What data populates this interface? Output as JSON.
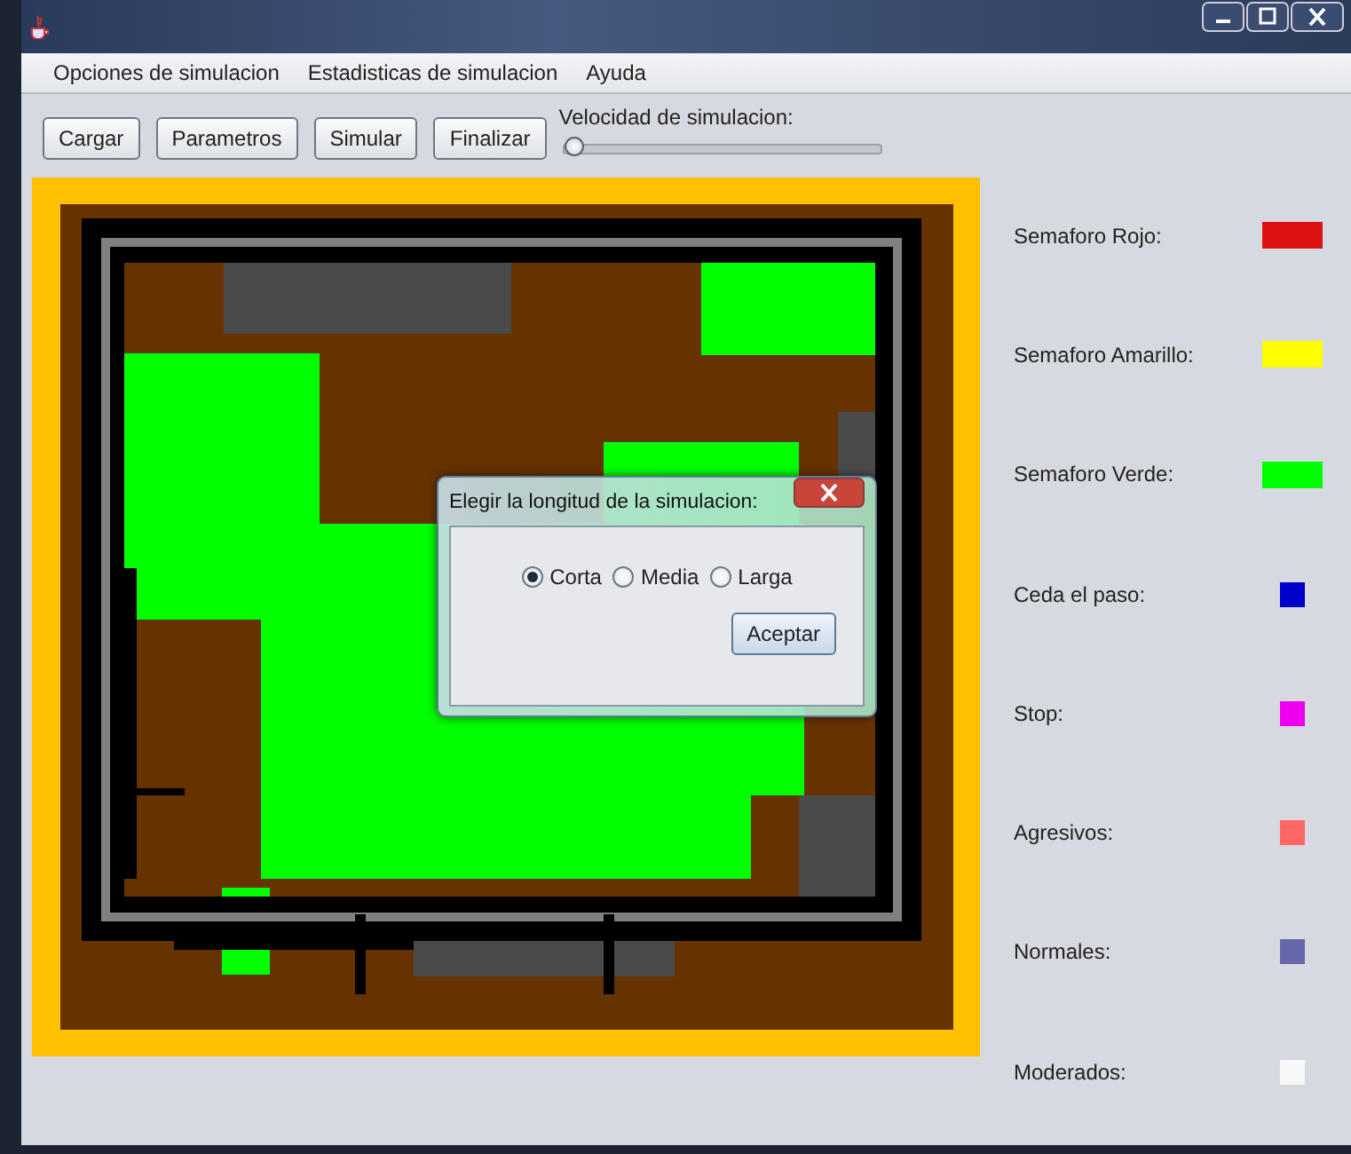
{
  "menu": [
    {
      "label": "Opciones de simulacion"
    },
    {
      "label": "Estadisticas de simulacion"
    },
    {
      "label": "Ayuda"
    }
  ],
  "toolbar": {
    "buttons": [
      "Cargar",
      "Parametros",
      "Simular",
      "Finalizar"
    ],
    "speed": {
      "label": "Velocidad de simulacion:",
      "level": 0
    }
  },
  "legend": [
    {
      "label": "Semaforo Rojo:",
      "color": "#dd1111",
      "kind": "wide"
    },
    {
      "label": "Semaforo Amarillo:",
      "color": "#ffff00",
      "kind": "wide"
    },
    {
      "label": "Semaforo Verde:",
      "color": "#00ff00",
      "kind": "wide"
    },
    {
      "label": "Ceda el paso:",
      "color": "#0000cc",
      "kind": "square"
    },
    {
      "label": "Stop:",
      "color": "#ee00ee",
      "kind": "square"
    },
    {
      "label": "Agresivos:",
      "color": "#ff6666",
      "kind": "square"
    },
    {
      "label": "Normales:",
      "color": "#6666aa",
      "kind": "square"
    },
    {
      "label": "Moderados:",
      "color": "#f8f8f8",
      "kind": "square"
    }
  ],
  "dialog": {
    "title": "Elegir la longitud de la simulacion:",
    "options": [
      {
        "label": "Corta",
        "selected": true
      },
      {
        "label": "Media",
        "selected": false
      },
      {
        "label": "Larga",
        "selected": false
      }
    ],
    "button": "Aceptar"
  }
}
